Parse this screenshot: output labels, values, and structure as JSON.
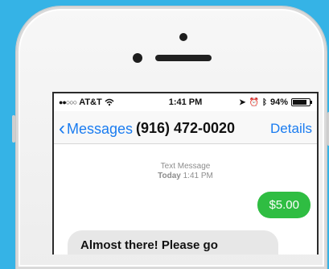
{
  "status_bar": {
    "carrier": "AT&T",
    "time": "1:41 PM",
    "battery_text": "94%",
    "battery_level": 0.94
  },
  "nav": {
    "back_label": "Messages",
    "title": "(916) 472-0020",
    "details_label": "Details"
  },
  "thread": {
    "meta_top": "Text Message",
    "meta_day": "Today",
    "meta_time": "1:41 PM"
  },
  "messages": [
    {
      "side": "sent",
      "text": "$5.00"
    },
    {
      "side": "received",
      "text": "Almost there! Please go"
    }
  ],
  "colors": {
    "background": "#35b3e6",
    "link_blue": "#1a7cf0",
    "sent_bubble": "#2fbd42",
    "received_bubble": "#e7e7e7"
  },
  "icons": [
    "signal-dots-icon",
    "wifi-icon",
    "location-arrow-icon",
    "alarm-icon",
    "bluetooth-icon",
    "battery-icon",
    "chevron-left-icon"
  ]
}
